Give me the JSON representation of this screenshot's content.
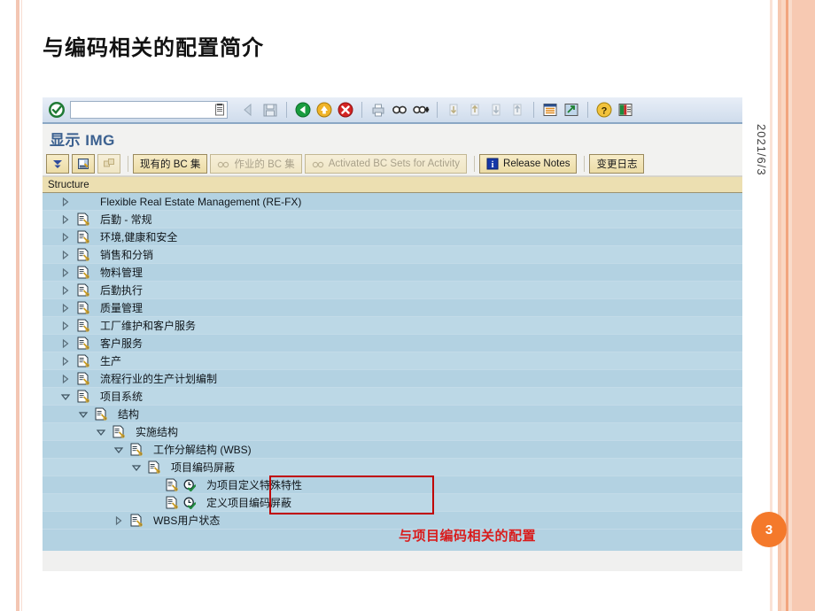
{
  "slide": {
    "title": "与编码相关的配置简介",
    "date": "2021/6/3",
    "page_number": "3",
    "annotation": "与项目编码相关的配置",
    "accent_color": "#f4792b",
    "annotation_color": "#d91c1c",
    "highlight_border_color": "#c00000"
  },
  "sap": {
    "command_field": {
      "value": "",
      "placeholder": ""
    },
    "screen_title": "显示 IMG",
    "toolbar_icons": [
      "enter-check-icon",
      "save-icon",
      "back-icon",
      "exit-icon",
      "cancel-icon",
      "print-icon",
      "find-icon",
      "find-next-icon",
      "first-page-icon",
      "previous-page-icon",
      "next-page-icon",
      "last-page-icon",
      "create-session-icon",
      "create-shortcut-icon",
      "help-icon",
      "customize-layout-icon"
    ],
    "app_buttons": [
      {
        "label": "",
        "name": "expand-subtree-button",
        "icon": "expand-icon",
        "disabled": false
      },
      {
        "label": "",
        "name": "documentation-button",
        "icon": "document-note-icon",
        "disabled": false
      },
      {
        "label": "",
        "name": "where-used-button",
        "icon": "where-used-icon",
        "disabled": true
      },
      {
        "label": "现有的 BC 集",
        "name": "existing-bc-sets-button",
        "icon": "",
        "disabled": false
      },
      {
        "label": "作业的 BC 集",
        "name": "bc-sets-for-activity-button",
        "icon": "glasses-icon",
        "disabled": true
      },
      {
        "label": "Activated BC Sets for Activity",
        "name": "activated-bc-sets-button",
        "icon": "glasses-icon",
        "disabled": true
      },
      {
        "label": "Release Notes",
        "name": "release-notes-button",
        "icon": "info-icon",
        "disabled": false
      },
      {
        "label": "变更日志",
        "name": "change-log-button",
        "icon": "",
        "disabled": false
      }
    ],
    "structure_header": "Structure",
    "tree": [
      {
        "label": "Flexible Real Estate Management (RE-FX)",
        "indent": 0,
        "state": "collapsed",
        "icon": "none"
      },
      {
        "label": "后勤 - 常规",
        "indent": 0,
        "state": "collapsed",
        "icon": "img-node-icon"
      },
      {
        "label": "环境,健康和安全",
        "indent": 0,
        "state": "collapsed",
        "icon": "img-node-icon"
      },
      {
        "label": "销售和分销",
        "indent": 0,
        "state": "collapsed",
        "icon": "img-node-icon"
      },
      {
        "label": "物料管理",
        "indent": 0,
        "state": "collapsed",
        "icon": "img-node-icon"
      },
      {
        "label": "后勤执行",
        "indent": 0,
        "state": "collapsed",
        "icon": "img-node-icon"
      },
      {
        "label": "质量管理",
        "indent": 0,
        "state": "collapsed",
        "icon": "img-node-icon"
      },
      {
        "label": "工厂维护和客户服务",
        "indent": 0,
        "state": "collapsed",
        "icon": "img-node-icon"
      },
      {
        "label": "客户服务",
        "indent": 0,
        "state": "collapsed",
        "icon": "img-node-icon"
      },
      {
        "label": "生产",
        "indent": 0,
        "state": "collapsed",
        "icon": "img-node-icon"
      },
      {
        "label": "流程行业的生产计划编制",
        "indent": 0,
        "state": "collapsed",
        "icon": "img-node-icon"
      },
      {
        "label": "项目系统",
        "indent": 0,
        "state": "expanded",
        "icon": "img-node-icon"
      },
      {
        "label": "结构",
        "indent": 1,
        "state": "expanded",
        "icon": "img-node-icon"
      },
      {
        "label": "实施结构",
        "indent": 2,
        "state": "expanded",
        "icon": "img-node-icon"
      },
      {
        "label": "工作分解结构 (WBS)",
        "indent": 3,
        "state": "expanded",
        "icon": "img-node-icon"
      },
      {
        "label": "项目编码屏蔽",
        "indent": 4,
        "state": "expanded",
        "icon": "img-node-icon"
      },
      {
        "label": "为项目定义特殊特性",
        "indent": 5,
        "state": "leaf",
        "icon": "activity-clock-icon"
      },
      {
        "label": "定义项目编码屏蔽",
        "indent": 5,
        "state": "leaf",
        "icon": "activity-clock-icon"
      },
      {
        "label": "WBS用户状态",
        "indent": 3,
        "state": "collapsed",
        "icon": "img-node-icon"
      }
    ]
  }
}
